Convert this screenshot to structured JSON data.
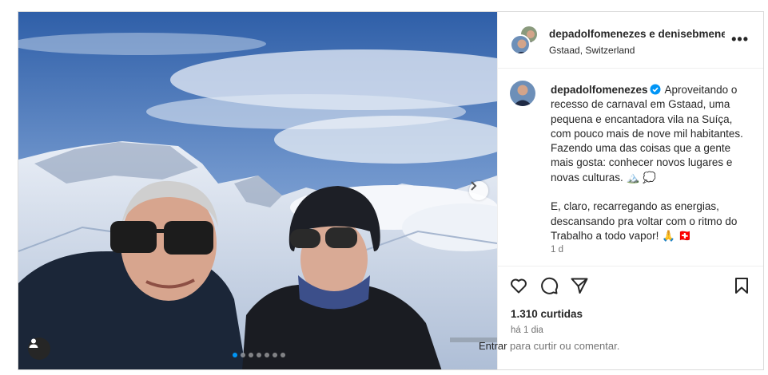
{
  "post": {
    "header": {
      "names": "depadolfomenezes e denisebmenezes",
      "location": "Gstaad, Switzerland",
      "more_icon": "more-horizontal-icon"
    },
    "caption": {
      "username": "depadolfomenezes",
      "paragraph1": "Aproveitando o recesso de carnaval em Gstaad, uma pequena e encantadora vila na Suíça, com pouco mais de nove mil habitantes. Fazendo uma das coisas que a gente mais gosta: conhecer novos lugares e novas culturas. 🏔️ 💭",
      "paragraph2": "E, claro, recarregando as energias, descansando pra voltar com o ritmo do Trabalho a todo vapor! 🙏 🇨🇭",
      "time": "1 d"
    },
    "likes": "1.310 curtidas",
    "posted": "há 1 dia",
    "login": {
      "link": "Entrar",
      "rest": "para curtir ou comentar."
    },
    "carousel": {
      "current": 1,
      "total": 7
    }
  },
  "icons": [
    "like-icon",
    "comment-icon",
    "share-icon",
    "save-icon",
    "next-arrow-icon",
    "tagged-user-icon",
    "verified-icon"
  ],
  "colors": {
    "accent": "#0095f6",
    "text": "#262626",
    "muted": "#737373",
    "border": "#dbdbdb"
  }
}
